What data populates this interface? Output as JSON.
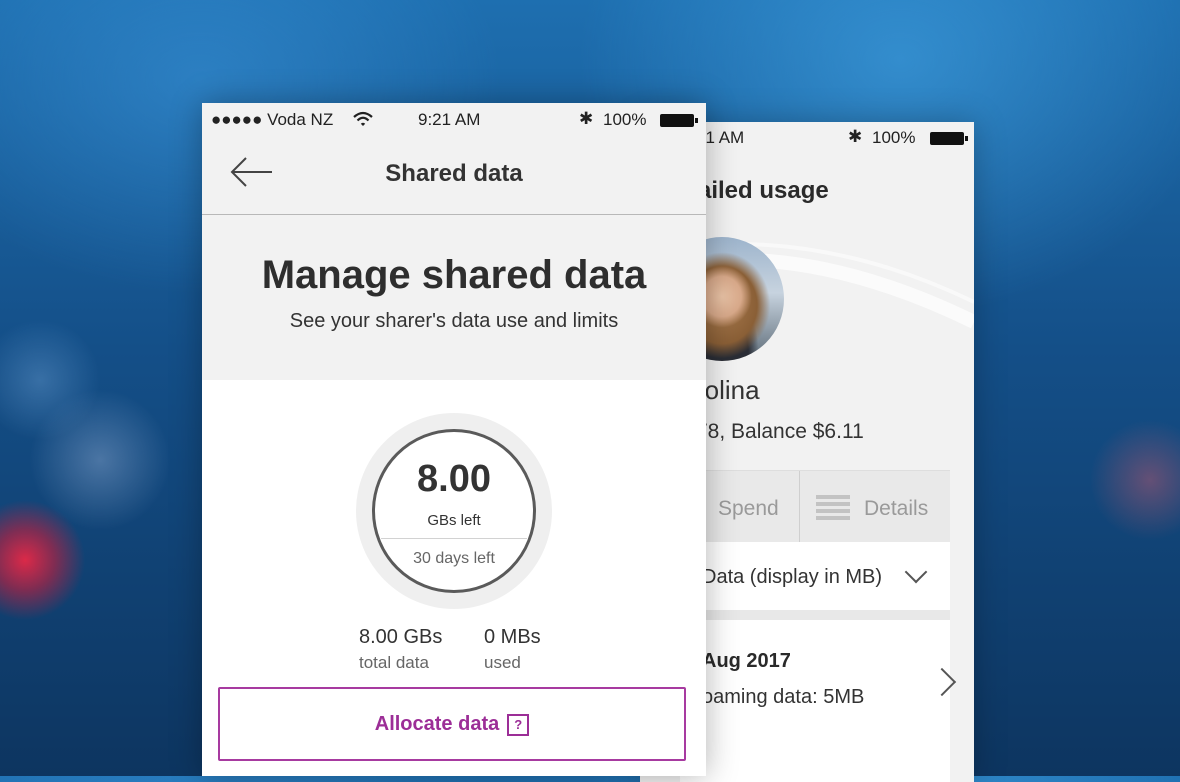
{
  "back_screen": {
    "status": {
      "time": "21 AM",
      "bluetooth": "✱",
      "battery_pct": "100%"
    },
    "title": "ailed usage",
    "profile": {
      "name": "rolina",
      "balance": "78, Balance $6.11"
    },
    "tabs": {
      "spend": "Spend",
      "details": "Details"
    },
    "filter": {
      "label": "Data (display in MB)"
    },
    "entry": {
      "date": "Aug 2017",
      "detail": "oaming data: 5MB"
    }
  },
  "front_screen": {
    "status": {
      "carrier": "●●●●● Voda NZ",
      "time": "9:21 AM",
      "bluetooth": "✱",
      "battery_pct": "100%"
    },
    "nav": {
      "title": "Shared data"
    },
    "hero": {
      "title": "Manage shared data",
      "subtitle": "See your sharer's data use and limits"
    },
    "ring": {
      "value": "8.00",
      "unit": "GBs left",
      "days": "30 days left"
    },
    "stats": {
      "total": {
        "value": "8.00 GBs",
        "label": "total data"
      },
      "used": {
        "value": "0 MBs",
        "label": "used"
      }
    },
    "allocate_button": {
      "label": "Allocate data",
      "help": "?"
    }
  },
  "colors": {
    "accent": "#9c2e97",
    "panel": "#f2f2f2",
    "background": "#144f88"
  }
}
